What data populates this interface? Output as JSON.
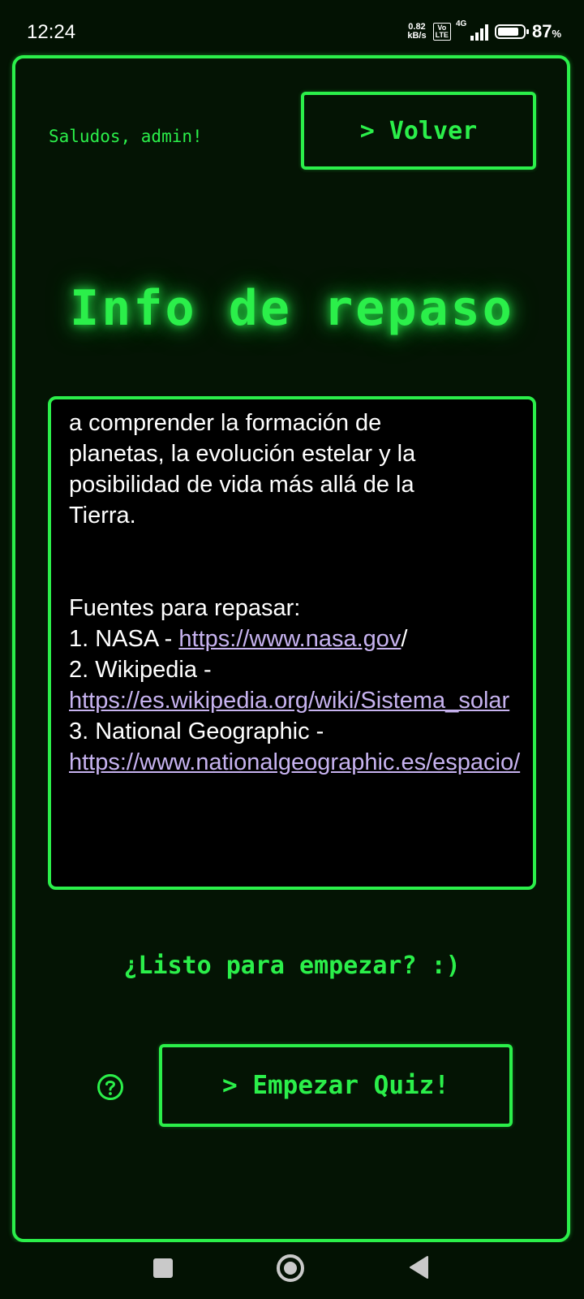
{
  "status_bar": {
    "time": "12:24",
    "net_speed_value": "0.82",
    "net_speed_unit": "kB/s",
    "volte_top": "Vo",
    "volte_bottom": "LTE",
    "network_type": "4G",
    "battery_percent": "87",
    "battery_percent_sign": "%",
    "battery_level": 0.87
  },
  "header": {
    "greeting": "Saludos, admin!",
    "back_button": "> Volver"
  },
  "title": "Info de repaso",
  "info": {
    "intro_lines": [
      "a comprender la formación de",
      "planetas, la evolución estelar y la",
      "posibilidad de vida más allá de la",
      "Tierra."
    ],
    "sources_heading": "Fuentes para repasar:",
    "source1_prefix": "1. NASA - ",
    "source1_link": "https://www.nasa.gov",
    "source1_suffix": "/",
    "source2_prefix": "2. Wikipedia -",
    "source2_link": "https://es.wikipedia.org/wiki/Sistema_solar",
    "source3_prefix": "3. National Geographic -",
    "source3_link": "https://www.nationalgeographic.es/espacio/"
  },
  "ready_text": "¿Listo para empezar? :)",
  "help_icon": "question-circle-icon",
  "start_button": "> Empezar Quiz!",
  "colors": {
    "accent": "#2bef4a",
    "background": "#031203",
    "link": "#c7b3f0"
  }
}
